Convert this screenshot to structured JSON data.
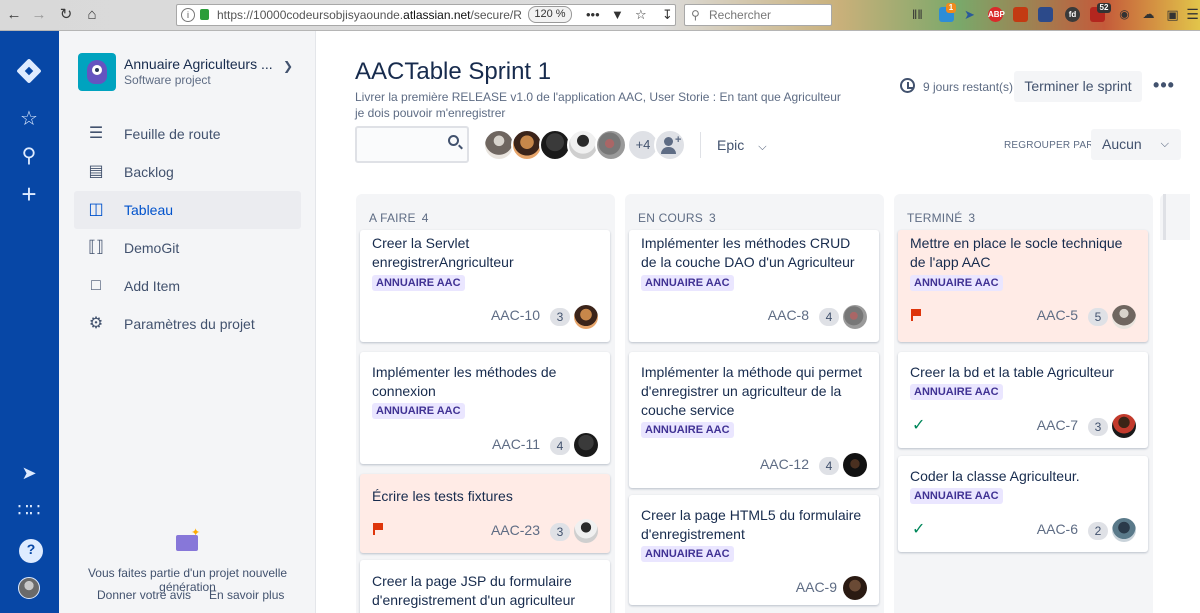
{
  "browser": {
    "url_prefix": "https://10000codeursobjisyaounde.",
    "url_domain": "atlassian.net",
    "url_suffix": "/secure/R",
    "zoom": "120 %",
    "search_placeholder": "Rechercher",
    "badges": {
      "ext1": "1",
      "ext2": "52"
    }
  },
  "project": {
    "name": "Annuaire Agriculteurs ...",
    "type": "Software project",
    "nav": [
      {
        "label": "Feuille de route",
        "icon": "roadmap-icon"
      },
      {
        "label": "Backlog",
        "icon": "backlog-icon"
      },
      {
        "label": "Tableau",
        "icon": "board-icon",
        "active": true
      },
      {
        "label": "DemoGit",
        "icon": "code-icon"
      },
      {
        "label": "Add Item",
        "icon": "add-item-icon"
      },
      {
        "label": "Paramètres du projet",
        "icon": "settings-icon"
      }
    ],
    "footer_text": "Vous faites partie d'un projet nouvelle génération",
    "feedback_link": "Donner votre avis",
    "learn_more_link": "En savoir plus"
  },
  "sprint": {
    "title": "AACTable Sprint 1",
    "goal": "Livrer la première RELEASE v1.0 de l'application AAC, User Storie : En tant que Agriculteur je dois pouvoir m'enregistrer",
    "days_left": "9 jours restant(s)",
    "end_button": "Terminer le sprint",
    "more": "•••"
  },
  "toolbar": {
    "more_avatars": "+4",
    "epic_label": "Epic",
    "group_label": "REGROUPER PAR",
    "group_value": "Aucun"
  },
  "colors": {
    "global_nav": "#0747a6",
    "flagged_card": "#ffebe6",
    "epic_lozenge_bg": "#eae6ff",
    "epic_lozenge_text": "#403294",
    "done_check": "#00875a",
    "flag": "#de350b"
  },
  "columns": [
    {
      "title": "A FAIRE",
      "count": "4",
      "cards": [
        {
          "summary": "Creer la Servlet enregistrerAngriculteur",
          "epic": "ANNUAIRE AAC",
          "key": "AAC-10",
          "estimate": "3"
        },
        {
          "summary": "Implémenter les méthodes de connexion",
          "epic": "ANNUAIRE AAC",
          "key": "AAC-11",
          "estimate": "4"
        },
        {
          "summary": "Écrire les tests fixtures",
          "key": "AAC-23",
          "estimate": "3",
          "flagged": true
        },
        {
          "summary": "Creer la page JSP du formulaire d'enregistrement d'un agriculteur"
        }
      ]
    },
    {
      "title": "EN COURS",
      "count": "3",
      "cards": [
        {
          "summary": "Implémenter les méthodes CRUD de la couche DAO d'un Agriculteur",
          "epic": "ANNUAIRE AAC",
          "key": "AAC-8",
          "estimate": "4"
        },
        {
          "summary": "Implémenter la méthode qui permet d'enregistrer un agriculteur de la couche service",
          "epic": "ANNUAIRE AAC",
          "key": "AAC-12",
          "estimate": "4"
        },
        {
          "summary": "Creer la page HTML5 du formulaire d'enregistrement",
          "epic": "ANNUAIRE AAC",
          "key": "AAC-9"
        }
      ]
    },
    {
      "title": "TERMINÉ",
      "count": "3",
      "cards": [
        {
          "summary": "Mettre en place le socle technique de l'app AAC",
          "epic": "ANNUAIRE AAC",
          "key": "AAC-5",
          "estimate": "5",
          "flagged": true
        },
        {
          "summary": "Creer la bd et la table Agriculteur",
          "epic": "ANNUAIRE AAC",
          "key": "AAC-7",
          "estimate": "3",
          "done": true
        },
        {
          "summary": "Coder la classe Agriculteur.",
          "epic": "ANNUAIRE AAC",
          "key": "AAC-6",
          "estimate": "2",
          "done": true
        }
      ]
    }
  ]
}
